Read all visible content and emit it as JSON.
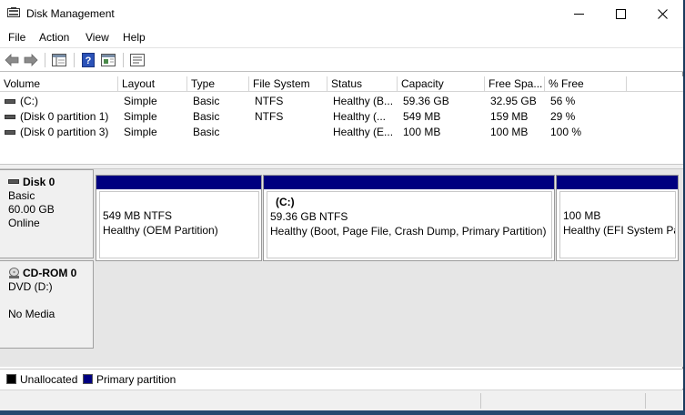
{
  "window": {
    "title": "Disk Management",
    "controls": [
      "minimize",
      "maximize",
      "close"
    ]
  },
  "menu": [
    "File",
    "Action",
    "View",
    "Help"
  ],
  "toolbar": {
    "icons": [
      "back-arrow-icon",
      "forward-arrow-icon",
      "console-tree-icon",
      "help-icon",
      "action-pane-icon",
      "properties-icon"
    ]
  },
  "volumes": {
    "columns": [
      "Volume",
      "Layout",
      "Type",
      "File System",
      "Status",
      "Capacity",
      "Free Spa...",
      "% Free"
    ],
    "rows": [
      [
        "(C:)",
        "Simple",
        "Basic",
        "NTFS",
        "Healthy (B...",
        "59.36 GB",
        "32.95 GB",
        "56 %"
      ],
      [
        "(Disk 0 partition 1)",
        "Simple",
        "Basic",
        "NTFS",
        "Healthy (...",
        "549 MB",
        "159 MB",
        "29 %"
      ],
      [
        "(Disk 0 partition 3)",
        "Simple",
        "Basic",
        "",
        "Healthy (E...",
        "100 MB",
        "100 MB",
        "100 %"
      ]
    ]
  },
  "disks": [
    {
      "name": "Disk 0",
      "type": "Basic",
      "size": "60.00 GB",
      "state": "Online",
      "partitions": [
        {
          "title": "",
          "size": "549 MB NTFS",
          "status": "Healthy (OEM Partition)"
        },
        {
          "title": "(C:)",
          "size": "59.36 GB NTFS",
          "status": "Healthy (Boot, Page File, Crash Dump, Primary Partition)"
        },
        {
          "title": "",
          "size": "100 MB",
          "status": "Healthy (EFI System Pa"
        }
      ]
    },
    {
      "name": "CD-ROM 0",
      "type": "DVD (D:)",
      "media": "No Media"
    }
  ],
  "legend": [
    {
      "label": "Unallocated",
      "color": "#000000"
    },
    {
      "label": "Primary partition",
      "color": "#000080"
    }
  ],
  "colors": {
    "partition_bar": "#000080",
    "unallocated": "#000000"
  }
}
